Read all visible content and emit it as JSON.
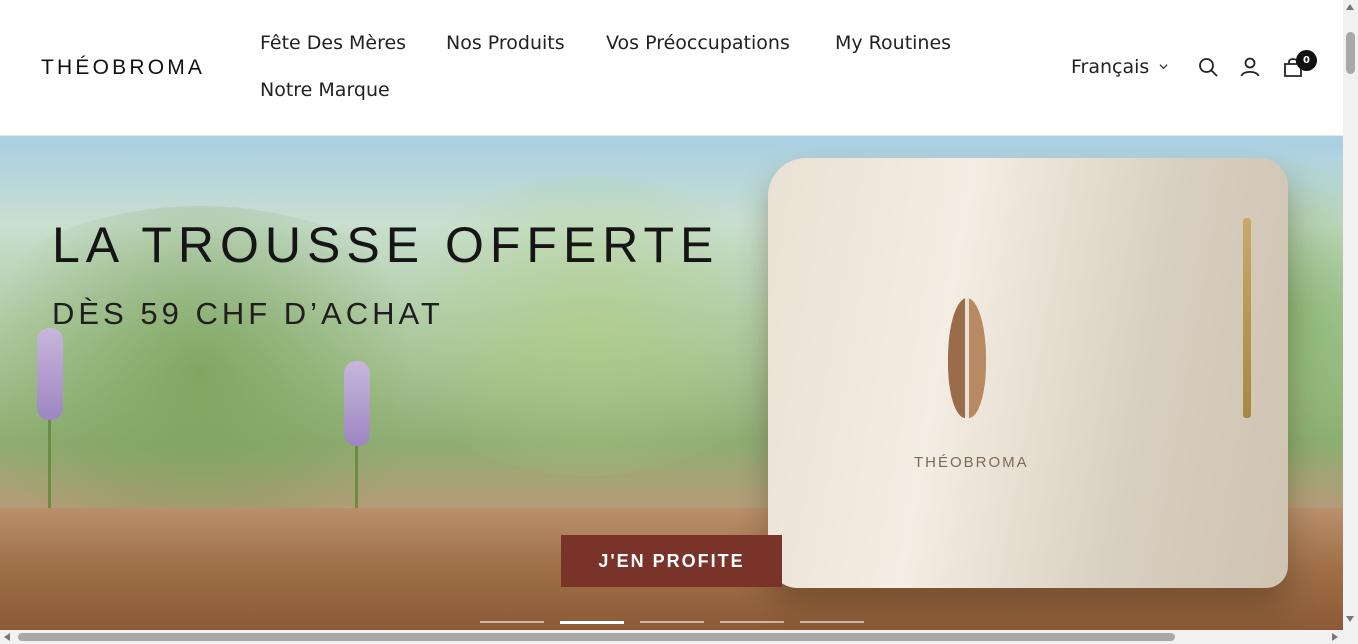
{
  "header": {
    "logo": "THÉOBROMA",
    "nav": [
      "Fête Des Mères",
      "Nos Produits",
      "Vos Préoccupations",
      "My Routines",
      "Notre Marque"
    ],
    "language": "Français",
    "cart_count": "0"
  },
  "hero": {
    "headline": "LA TROUSSE OFFERTE",
    "subheadline": "DÈS 59 CHF D’ACHAT",
    "cta_label": "J'EN PROFITE",
    "pouch_brand": "THÉOBROMA",
    "slides_total": 5,
    "slides_active_index": 1
  },
  "colors": {
    "cta_background": "#7a3329",
    "text": "#1c1c1c"
  },
  "icons": [
    "search-icon",
    "account-icon",
    "cart-icon",
    "chevron-down-icon"
  ]
}
